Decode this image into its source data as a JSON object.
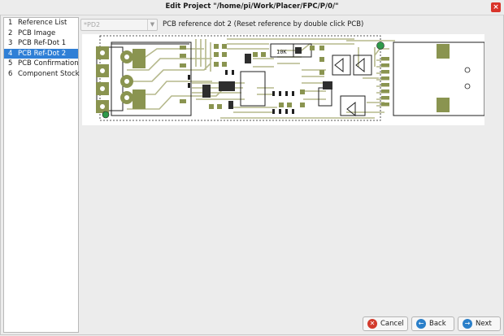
{
  "window": {
    "title": "Edit Project \"/home/pi/Work/Placer/FPC/P/0/\""
  },
  "steps": [
    {
      "num": "1",
      "label": "Reference List"
    },
    {
      "num": "2",
      "label": "PCB Image"
    },
    {
      "num": "3",
      "label": "PCB Ref-Dot 1"
    },
    {
      "num": "4",
      "label": "PCB Ref-Dot 2"
    },
    {
      "num": "5",
      "label": "PCB Confirmation"
    },
    {
      "num": "6",
      "label": "Component Stock"
    }
  ],
  "active_step": 3,
  "ref_select": {
    "value": "*PD2"
  },
  "instruction": "PCB reference dot 2 (Reset reference by double click PCB)",
  "pcb_labels": {
    "chip": "10K"
  },
  "buttons": {
    "cancel": "Cancel",
    "back": "Back",
    "next": "Next"
  },
  "colors": {
    "accent": "#2f7fd6",
    "pad": "#8a9450",
    "trace": "#b5b88c",
    "silk": "#1f1f1f",
    "cancel_icon": "#d23a2c",
    "nav_icon": "#2a7fc9",
    "ref_dot": "#2f9a4a"
  },
  "icons": {
    "cancel": "x-circle-icon",
    "back": "arrow-left-circle-icon",
    "next": "arrow-right-circle-icon"
  }
}
